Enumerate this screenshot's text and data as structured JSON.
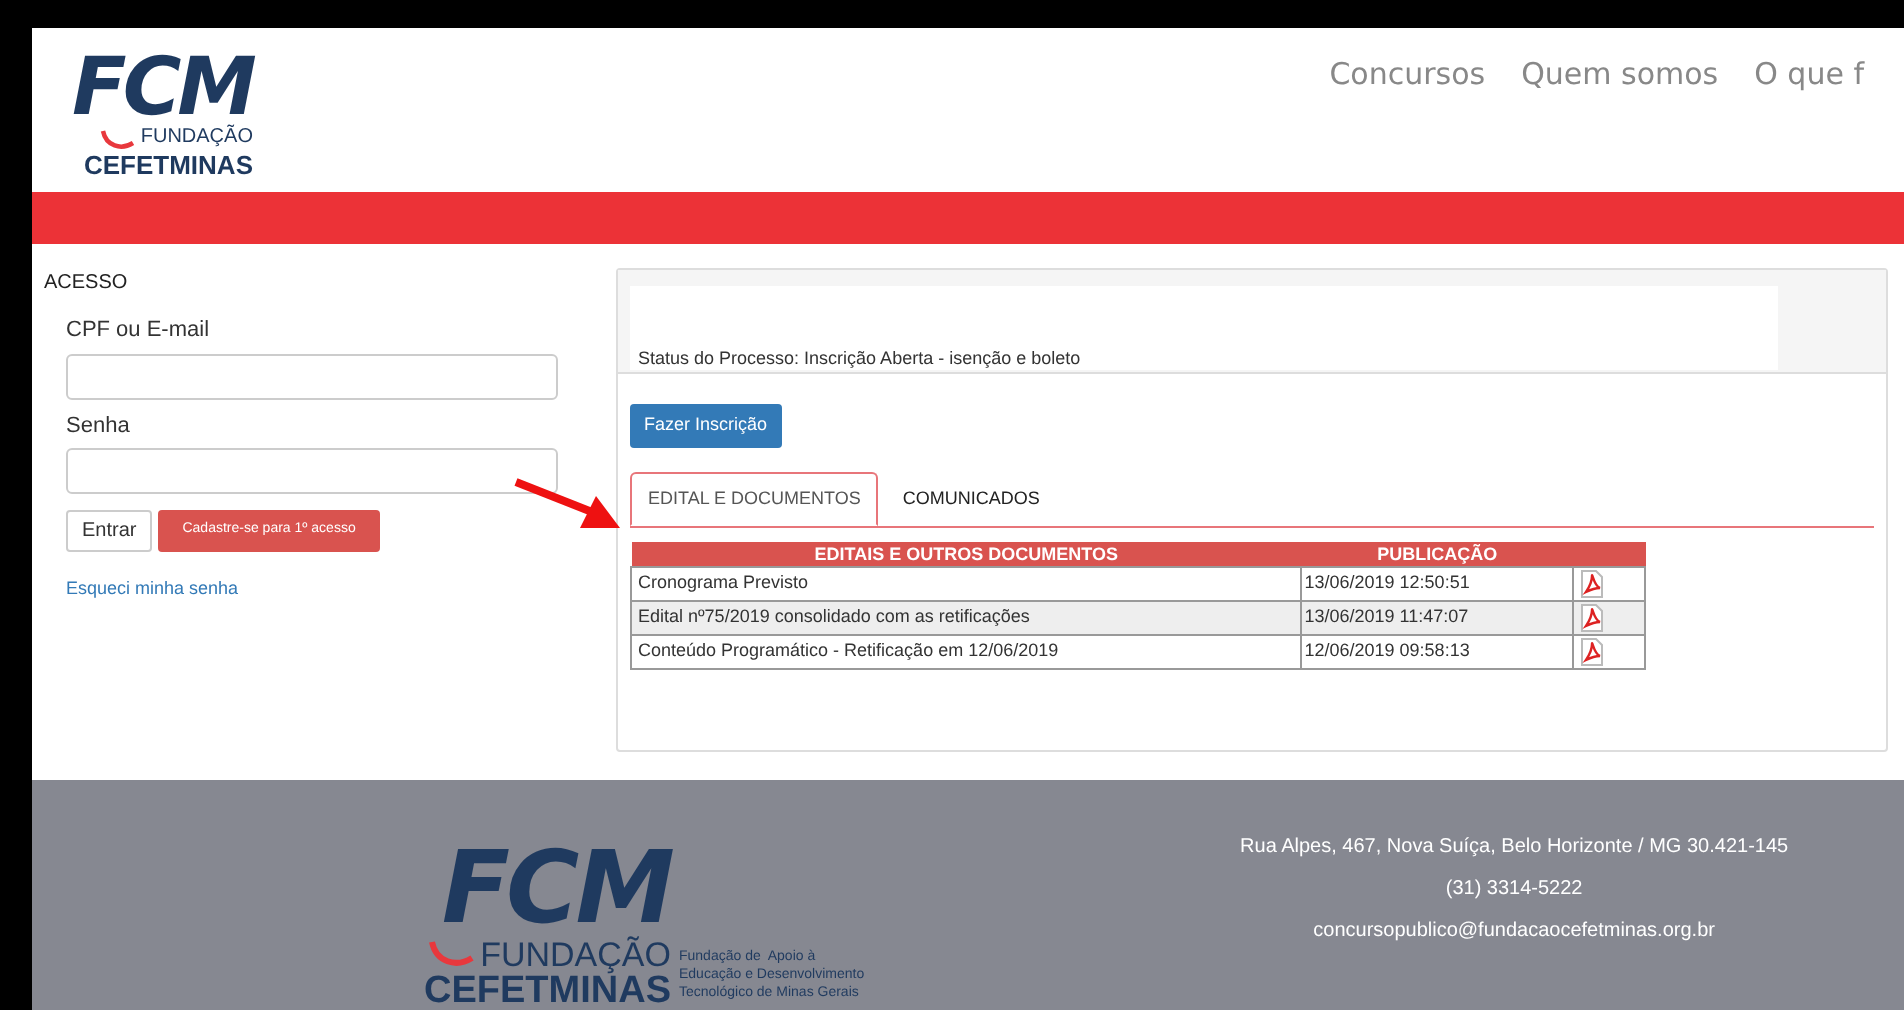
{
  "header": {
    "logo": {
      "mark": "FCM",
      "line1": "FUNDAÇÃO",
      "line2": "CEFETMINAS"
    },
    "nav": [
      {
        "label": "Concursos"
      },
      {
        "label": "Quem somos"
      },
      {
        "label": "O que f"
      }
    ]
  },
  "login": {
    "title": "ACESSO",
    "fields": [
      {
        "label": "CPF ou E-mail"
      },
      {
        "label": "Senha"
      }
    ],
    "buttons": [
      {
        "label": "Entrar",
        "kind": "plain"
      },
      {
        "label": "Cadastre-se para 1º acesso",
        "kind": "danger"
      }
    ],
    "link": "Esqueci minha senha"
  },
  "process": {
    "status": "Status do Processo: Inscrição Aberta - isenção e boleto",
    "button": "Fazer Inscrição",
    "tabs": [
      {
        "label": "EDITAL E DOCUMENTOS",
        "selected": true
      },
      {
        "label": "COMUNICADOS",
        "selected": false
      }
    ],
    "table": {
      "columns": [
        "EDITAIS E OUTROS DOCUMENTOS",
        "PUBLICAÇÃO"
      ],
      "rows": [
        {
          "title": "Cronograma Previsto",
          "date": "13/06/2019 12:50:51"
        },
        {
          "title": "Edital nº75/2019 consolidado com as retificações",
          "date": "13/06/2019 11:47:07"
        },
        {
          "title": "Conteúdo Programático - Retificação em 12/06/2019",
          "date": "12/06/2019 09:58:13"
        }
      ]
    }
  },
  "footer": {
    "logo": {
      "mark": "FCM",
      "line1": "FUNDAÇÃO",
      "line2": "CEFETMINAS",
      "tagline": [
        "Fundação de  Apoio à",
        "Educação e Desenvolvimento",
        "Tecnológico de Minas Gerais"
      ]
    },
    "contact": [
      "Rua Alpes, 467, Nova Suíça, Belo Horizonte / MG 30.421-145",
      "(31) 3314-5222",
      "concursopublico@fundacaocefetminas.org.br"
    ]
  }
}
